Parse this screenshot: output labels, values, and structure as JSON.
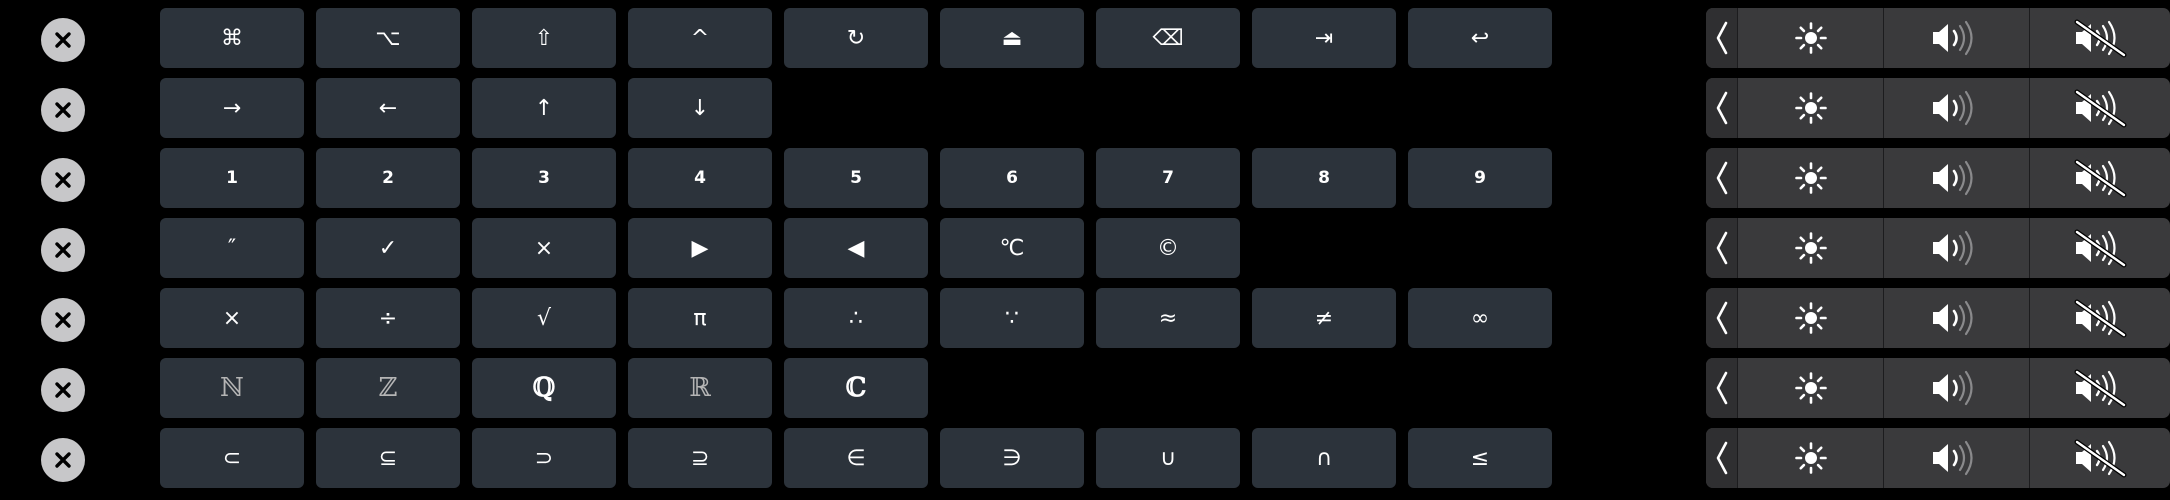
{
  "colors": {
    "background": "#000000",
    "key_background": "#2c333b",
    "close_button": "#c7c7c9",
    "control_strip": "#3a3a3c"
  },
  "rows": [
    {
      "keys": [
        "⌘",
        "⌥",
        "⇧",
        "^",
        "↻",
        "⏏",
        "⌫",
        "⇥",
        "↩"
      ],
      "key_names": [
        "command-key",
        "option-key",
        "shift-key",
        "control-key",
        "rotate-key",
        "eject-key",
        "delete-key",
        "tab-key",
        "return-key"
      ]
    },
    {
      "keys": [
        "→",
        "←",
        "↑",
        "↓"
      ],
      "key_names": [
        "right-arrow-key",
        "left-arrow-key",
        "up-arrow-key",
        "down-arrow-key"
      ]
    },
    {
      "keys": [
        "1",
        "2",
        "3",
        "4",
        "5",
        "6",
        "7",
        "8",
        "9"
      ],
      "key_names": [
        "digit-1-key",
        "digit-2-key",
        "digit-3-key",
        "digit-4-key",
        "digit-5-key",
        "digit-6-key",
        "digit-7-key",
        "digit-8-key",
        "digit-9-key"
      ]
    },
    {
      "keys": [
        "″",
        "✓",
        "×",
        "▶",
        "◀",
        "℃",
        "©"
      ],
      "key_names": [
        "double-prime-key",
        "check-mark-key",
        "multiplication-sign-key",
        "play-key",
        "reverse-key",
        "celsius-key",
        "copyright-key"
      ]
    },
    {
      "keys": [
        "×",
        "÷",
        "√",
        "π",
        "∴",
        "∵",
        "≈",
        "≠",
        "∞"
      ],
      "key_names": [
        "times-key",
        "divide-key",
        "square-root-key",
        "pi-key",
        "therefore-key",
        "because-key",
        "approx-key",
        "not-equal-key",
        "infinity-key"
      ]
    },
    {
      "keys": [
        "ℕ",
        "ℤ",
        "ℚ",
        "ℝ",
        "ℂ"
      ],
      "key_names": [
        "naturals-key",
        "integers-key",
        "rationals-key",
        "reals-key",
        "complex-key"
      ]
    },
    {
      "keys": [
        "⊂",
        "⊆",
        "⊃",
        "⊇",
        "∈",
        "∋",
        "∪",
        "∩",
        "≤"
      ],
      "key_names": [
        "subset-key",
        "subset-equal-key",
        "superset-key",
        "superset-equal-key",
        "element-of-key",
        "contains-key",
        "union-key",
        "intersection-key",
        "less-equal-key"
      ]
    }
  ],
  "control_strip": {
    "icons": [
      "chevron-left-icon",
      "brightness-icon",
      "volume-icon",
      "mute-icon"
    ]
  }
}
